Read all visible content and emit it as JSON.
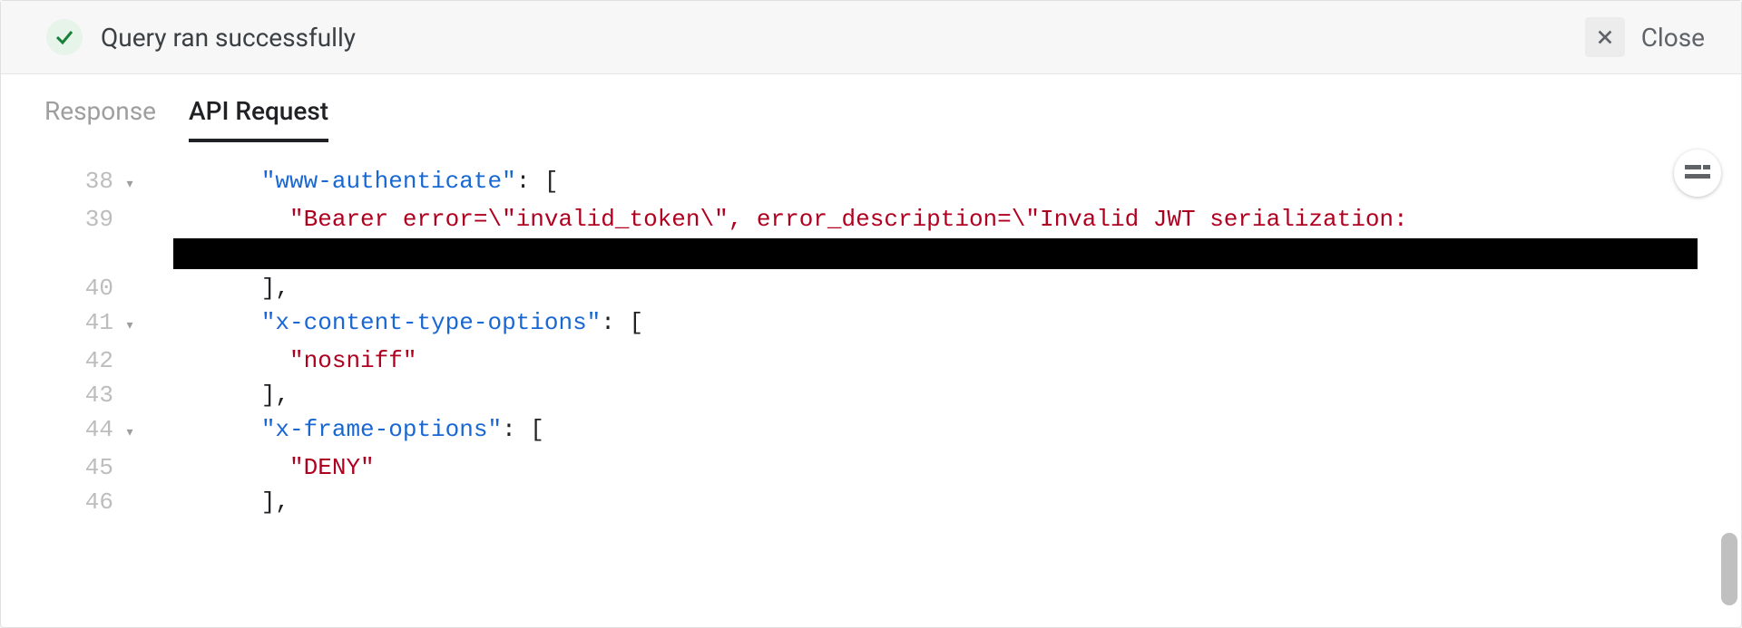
{
  "header": {
    "status_text": "Query ran successfully",
    "close_label": "Close"
  },
  "tabs": {
    "response": "Response",
    "api_request": "API Request",
    "active": "api_request"
  },
  "code": {
    "lines": [
      {
        "num": "38",
        "fold": "▾",
        "indent": "        ",
        "key": "\"www-authenticate\"",
        "punct1": ": [",
        "str": "",
        "punct2": ""
      },
      {
        "num": "39",
        "fold": "",
        "indent": "          ",
        "key": "",
        "punct1": "",
        "str": "\"Bearer error=\\\"invalid_token\\\", error_description=\\\"Invalid JWT serialization:",
        "punct2": ""
      },
      {
        "num": "40",
        "fold": "",
        "indent": "        ",
        "key": "",
        "punct1": "],",
        "str": "",
        "punct2": ""
      },
      {
        "num": "41",
        "fold": "▾",
        "indent": "        ",
        "key": "\"x-content-type-options\"",
        "punct1": ": [",
        "str": "",
        "punct2": ""
      },
      {
        "num": "42",
        "fold": "",
        "indent": "          ",
        "key": "",
        "punct1": "",
        "str": "\"nosniff\"",
        "punct2": ""
      },
      {
        "num": "43",
        "fold": "",
        "indent": "        ",
        "key": "",
        "punct1": "],",
        "str": "",
        "punct2": ""
      },
      {
        "num": "44",
        "fold": "▾",
        "indent": "        ",
        "key": "\"x-frame-options\"",
        "punct1": ": [",
        "str": "",
        "punct2": ""
      },
      {
        "num": "45",
        "fold": "",
        "indent": "          ",
        "key": "",
        "punct1": "",
        "str": "\"DENY\"",
        "punct2": ""
      },
      {
        "num": "46",
        "fold": "",
        "indent": "        ",
        "key": "",
        "punct1": "],",
        "str": "",
        "punct2": ""
      }
    ],
    "redacted_after_line": "39"
  }
}
